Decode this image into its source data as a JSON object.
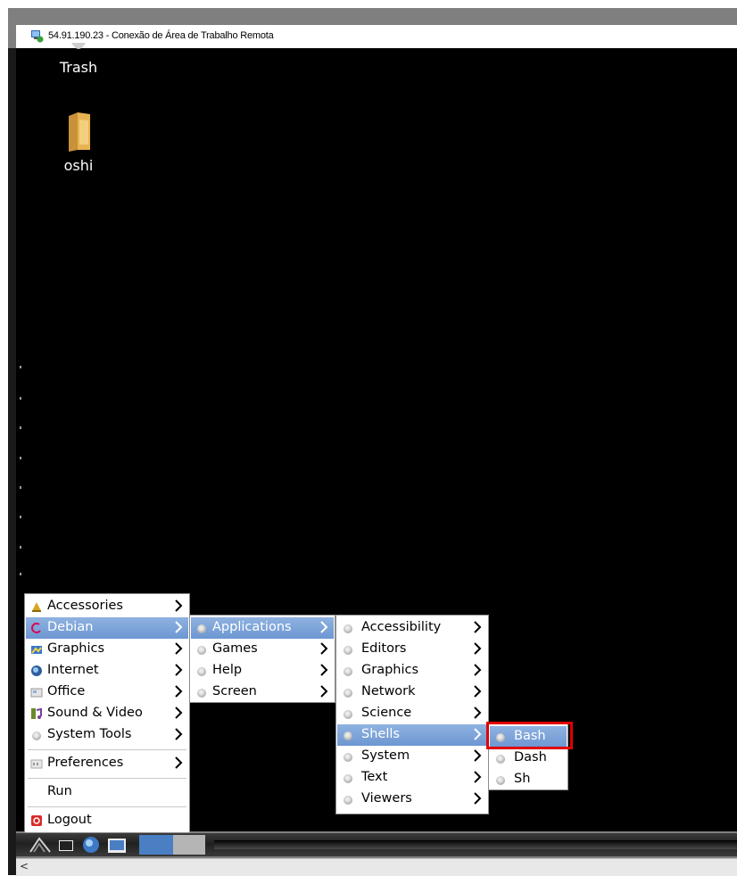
{
  "window": {
    "title": "54.91.190.23 - Conexão de Área de Trabalho Remota"
  },
  "desktop_icons": [
    {
      "label": "Trash",
      "icon": "trash-icon"
    },
    {
      "label": "oshi",
      "icon": "folder-icon"
    }
  ],
  "main_menu": {
    "items": [
      {
        "label": "Accessories",
        "icon": "accessories-icon",
        "submenu": true
      },
      {
        "label": "Debian",
        "icon": "debian-icon",
        "submenu": true,
        "selected": true
      },
      {
        "label": "Graphics",
        "icon": "graphics-icon",
        "submenu": true
      },
      {
        "label": "Internet",
        "icon": "internet-icon",
        "submenu": true
      },
      {
        "label": "Office",
        "icon": "office-icon",
        "submenu": true
      },
      {
        "label": "Sound & Video",
        "icon": "sound-video-icon",
        "submenu": true
      },
      {
        "label": "System Tools",
        "icon": "gear-icon",
        "submenu": true
      },
      {
        "label": "Preferences",
        "icon": "preferences-icon",
        "submenu": true
      },
      {
        "label": "Run",
        "icon": "",
        "submenu": false
      },
      {
        "label": "Logout",
        "icon": "logout-icon",
        "submenu": false
      }
    ]
  },
  "debian_menu": {
    "items": [
      {
        "label": "Applications",
        "selected": true
      },
      {
        "label": "Games"
      },
      {
        "label": "Help"
      },
      {
        "label": "Screen"
      }
    ]
  },
  "applications_menu": {
    "items": [
      {
        "label": "Accessibility"
      },
      {
        "label": "Editors"
      },
      {
        "label": "Graphics"
      },
      {
        "label": "Network"
      },
      {
        "label": "Science"
      },
      {
        "label": "Shells",
        "selected": true
      },
      {
        "label": "System"
      },
      {
        "label": "Text"
      },
      {
        "label": "Viewers"
      }
    ]
  },
  "shells_menu": {
    "items": [
      {
        "label": "Bash",
        "selected": true,
        "highlighted": true
      },
      {
        "label": "Dash"
      },
      {
        "label": "Sh"
      }
    ]
  },
  "colors": {
    "selection": "#7aa0d6",
    "highlight_box": "#e00000",
    "desktop_bg": "#000000"
  },
  "taskbar": {
    "launchers": [
      "start-menu-icon",
      "terminal-icon",
      "browser-icon",
      "window-icon"
    ]
  },
  "scrollbar": {
    "left_arrow": "<"
  }
}
